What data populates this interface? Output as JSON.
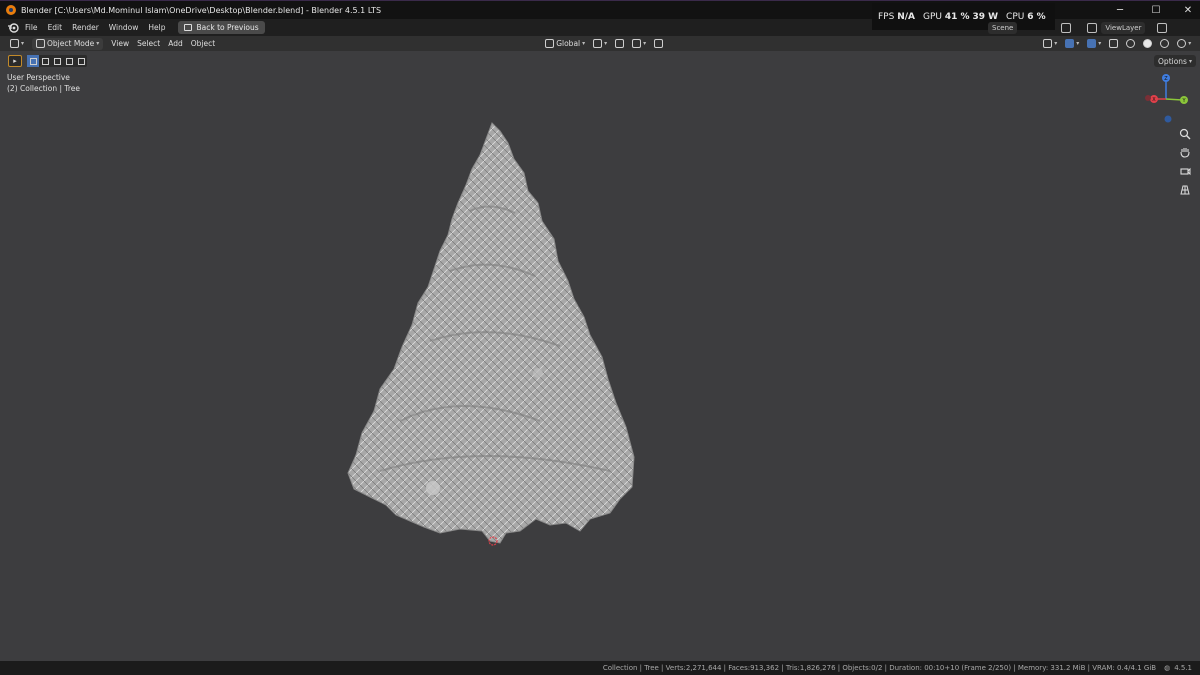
{
  "window": {
    "title": "Blender [C:\\Users\\Md.Mominul Islam\\OneDrive\\Desktop\\Blender.blend] - Blender 4.5.1 LTS",
    "minimize": "─",
    "maximize": "☐",
    "close": "✕"
  },
  "menu": {
    "items": [
      "File",
      "Edit",
      "Render",
      "Window",
      "Help"
    ],
    "back_button": "Back to Previous"
  },
  "perf": {
    "fps_label": "FPS",
    "fps_value": "N/A",
    "gpu_label": "GPU",
    "gpu_value": "41 %",
    "gpu_power": "39 W",
    "cpu_label": "CPU",
    "cpu_value": "6 %"
  },
  "top_right": {
    "scene": "Scene",
    "view_layer": "ViewLayer"
  },
  "header": {
    "mode": "Object Mode",
    "menus": [
      "View",
      "Select",
      "Add",
      "Object"
    ],
    "transform_orientation": "Global"
  },
  "viewport": {
    "perspective": "User Perspective",
    "collection": "(2) Collection | Tree",
    "options": "Options"
  },
  "gizmo": {
    "z": "Z",
    "x": "X",
    "y": "Y"
  },
  "statusbar": {
    "text": "Collection | Tree | Verts:2,271,644 | Faces:913,362 | Tris:1,826,276 | Objects:0/2 | Duration: 00:10+10 (Frame 2/250) | Memory: 331.2 MiB | VRAM: 0.4/4.1 GiB",
    "version": "4.5.1"
  },
  "colors": {
    "viewport_bg": "#3d3d3f",
    "accent": "#4772b3",
    "axis_x": "#e0404a",
    "axis_y": "#8bc63a",
    "axis_z": "#3f7de0"
  }
}
